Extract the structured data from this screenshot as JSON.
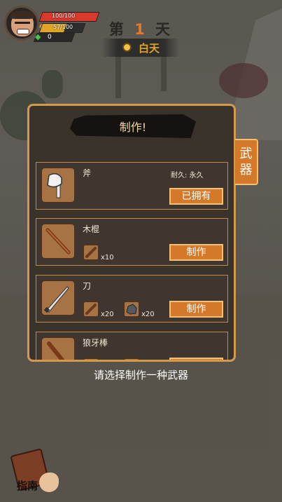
{
  "hud": {
    "hp_text": "100/100",
    "food_text": "57/100",
    "food_fraction": 0.57,
    "gems": "0"
  },
  "day": {
    "prefix": "第",
    "number": "1",
    "suffix": "天",
    "time_of_day": "白天"
  },
  "craft": {
    "title": "制作!",
    "tab_label": "武器",
    "items": [
      {
        "name": "斧",
        "icon": "axe-icon",
        "durability": "耐久: 永久",
        "button": "已拥有",
        "materials": []
      },
      {
        "name": "木棍",
        "icon": "stick-icon",
        "durability": "",
        "button": "制作",
        "materials": [
          {
            "icon": "wood-icon",
            "qty": "x10"
          }
        ]
      },
      {
        "name": "刀",
        "icon": "knife-icon",
        "durability": "",
        "button": "制作",
        "materials": [
          {
            "icon": "wood-icon",
            "qty": "x20"
          },
          {
            "icon": "stone-icon",
            "qty": "x20"
          }
        ]
      },
      {
        "name": "狼牙棒",
        "icon": "club-icon",
        "durability": "",
        "button": "",
        "materials": []
      }
    ]
  },
  "hint": "请选择制作一种武器",
  "guide_label": "指南",
  "colors": {
    "accent": "#d4782a",
    "border": "#d49a4c",
    "hp": "#d9392b",
    "food": "#e0a528"
  }
}
